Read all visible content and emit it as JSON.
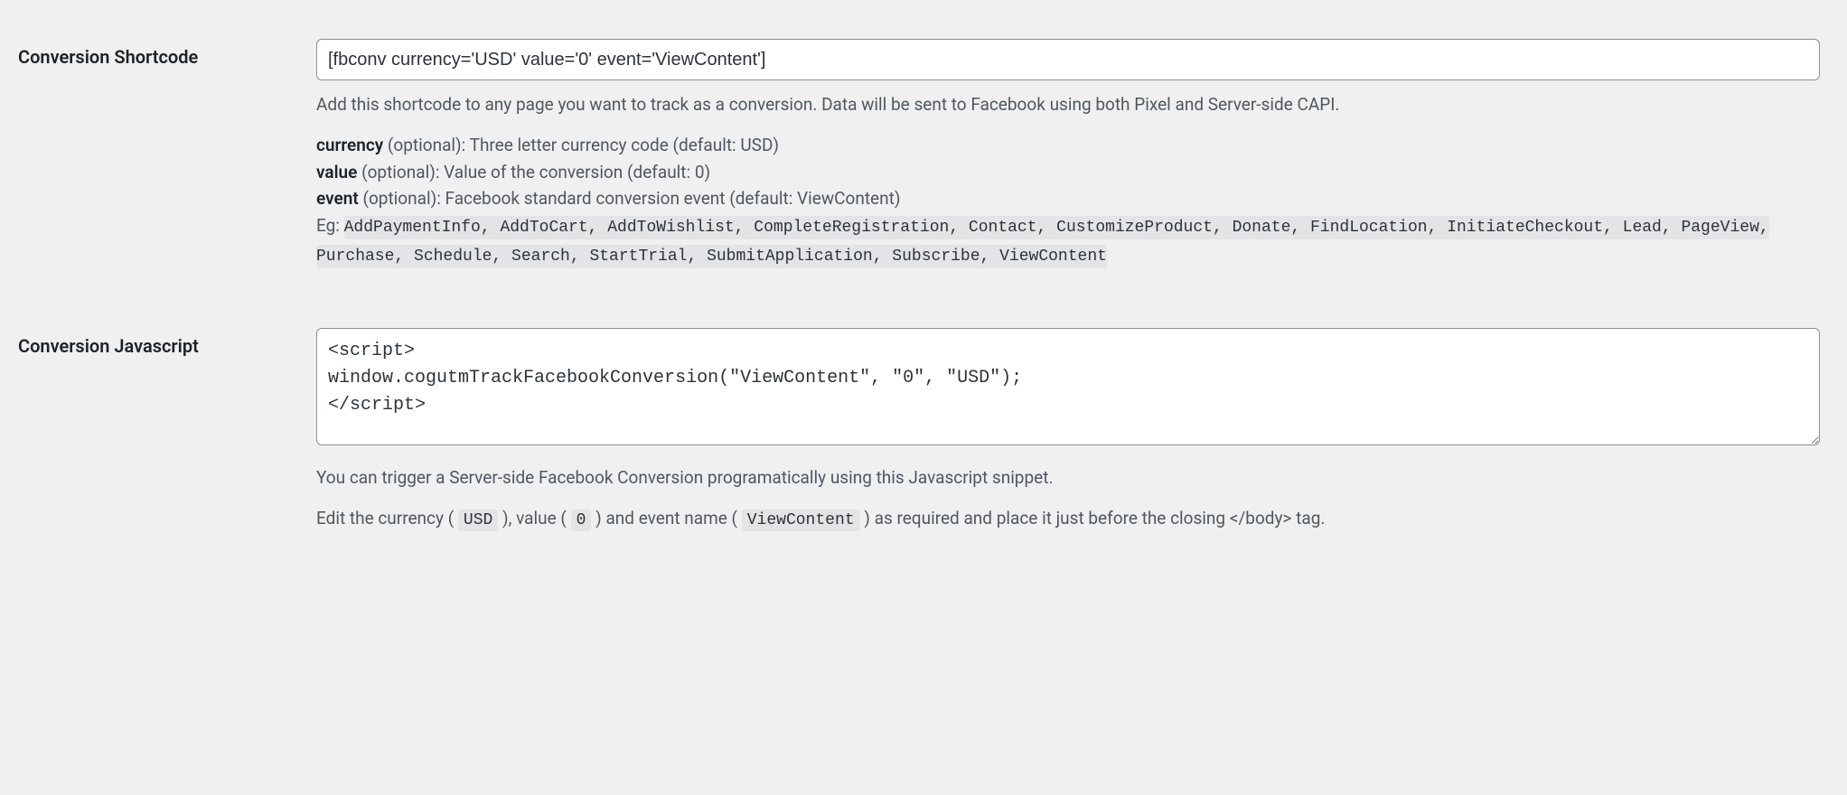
{
  "shortcode": {
    "label": "Conversion Shortcode",
    "value": "[fbconv currency='USD' value='0' event='ViewContent']",
    "help": "Add this shortcode to any page you want to track as a conversion. Data will be sent to Facebook using both Pixel and Server-side CAPI.",
    "params": {
      "currency_name": "currency",
      "currency_desc": " (optional): Three letter currency code (default: USD)",
      "value_name": "value",
      "value_desc": " (optional): Value of the conversion (default: 0)",
      "event_name": "event",
      "event_desc": " (optional): Facebook standard conversion event (default: ViewContent)"
    },
    "events_prefix": "Eg: ",
    "events_list": "AddPaymentInfo, AddToCart, AddToWishlist, CompleteRegistration, Contact, CustomizeProduct, Donate, FindLocation, InitiateCheckout, Lead, PageView, Purchase, Schedule, Search, StartTrial, SubmitApplication, Subscribe, ViewContent"
  },
  "javascript": {
    "label": "Conversion Javascript",
    "value": "<script>\nwindow.cogutmTrackFacebookConversion(\"ViewContent\", \"0\", \"USD\");\n</script>",
    "help1": "You can trigger a Server-side Facebook Conversion programatically using this Javascript snippet.",
    "help2_a": "Edit the currency ( ",
    "help2_currency": "USD",
    "help2_b": " ), value ( ",
    "help2_value": "0",
    "help2_c": " ) and event name ( ",
    "help2_event": "ViewContent",
    "help2_d": " ) as required and place it just before the closing </body> tag."
  }
}
